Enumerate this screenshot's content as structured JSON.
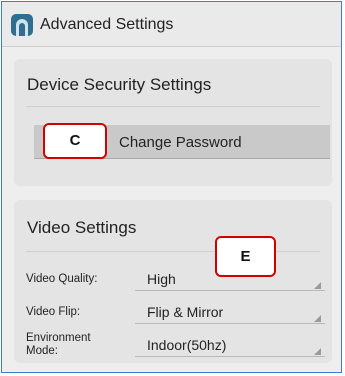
{
  "header": {
    "title": "Advanced Settings",
    "icon": "app-settings-icon"
  },
  "security": {
    "section_title": "Device Security Settings",
    "change_password_label": "Change Password"
  },
  "video": {
    "section_title": "Video Settings",
    "rows": [
      {
        "label": "Video Quality:",
        "value": "High"
      },
      {
        "label": "Video Flip:",
        "value": "Flip & Mirror"
      },
      {
        "label": "Environment Mode:",
        "value": "Indoor(50hz)"
      }
    ]
  },
  "callouts": {
    "c": "C",
    "e": "E"
  },
  "colors": {
    "frame_border": "#3b7fd0",
    "callout_border": "#d10000",
    "card_background": "#e4e4e4",
    "button_background": "#c9c9c9"
  }
}
